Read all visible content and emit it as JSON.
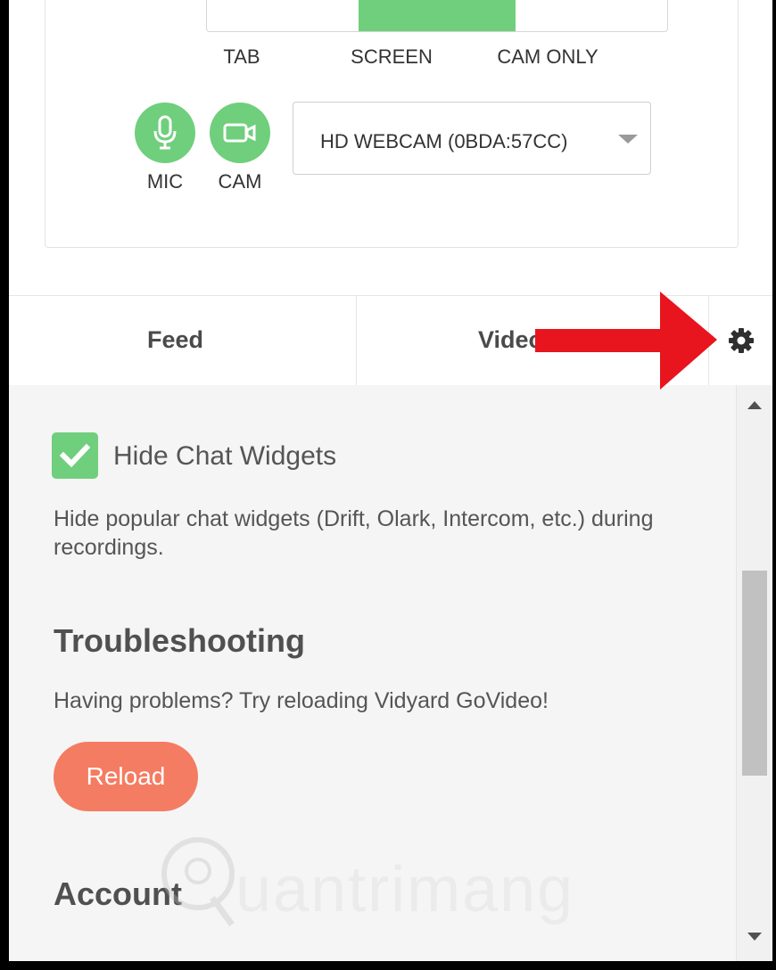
{
  "recorder": {
    "modes": [
      {
        "label": "TAB",
        "selected": false
      },
      {
        "label": "SCREEN",
        "selected": true
      },
      {
        "label": "CAM ONLY",
        "selected": false
      }
    ],
    "mic": {
      "label": "MIC",
      "icon": "microphone-icon"
    },
    "cam": {
      "label": "CAM",
      "icon": "video-camera-icon"
    },
    "camera_select": {
      "value": "HD WEBCAM (0BDA:57CC)"
    },
    "accent_color": "#6fcf7c"
  },
  "tabs": {
    "feed": "Feed",
    "videos": "Videos",
    "settings_icon": "gear-icon"
  },
  "settings": {
    "hide_chat": {
      "label": "Hide Chat Widgets",
      "checked": true,
      "description": "Hide popular chat widgets (Drift, Olark, Intercom, etc.) during recordings."
    },
    "troubleshooting": {
      "heading": "Troubleshooting",
      "description": "Having problems? Try reloading Vidyard GoVideo!",
      "reload_label": "Reload",
      "reload_color": "#f47c62"
    },
    "account": {
      "heading": "Account"
    }
  },
  "watermark": {
    "text": "uantrimang"
  },
  "annotation": {
    "arrow_color": "#e8141e"
  }
}
